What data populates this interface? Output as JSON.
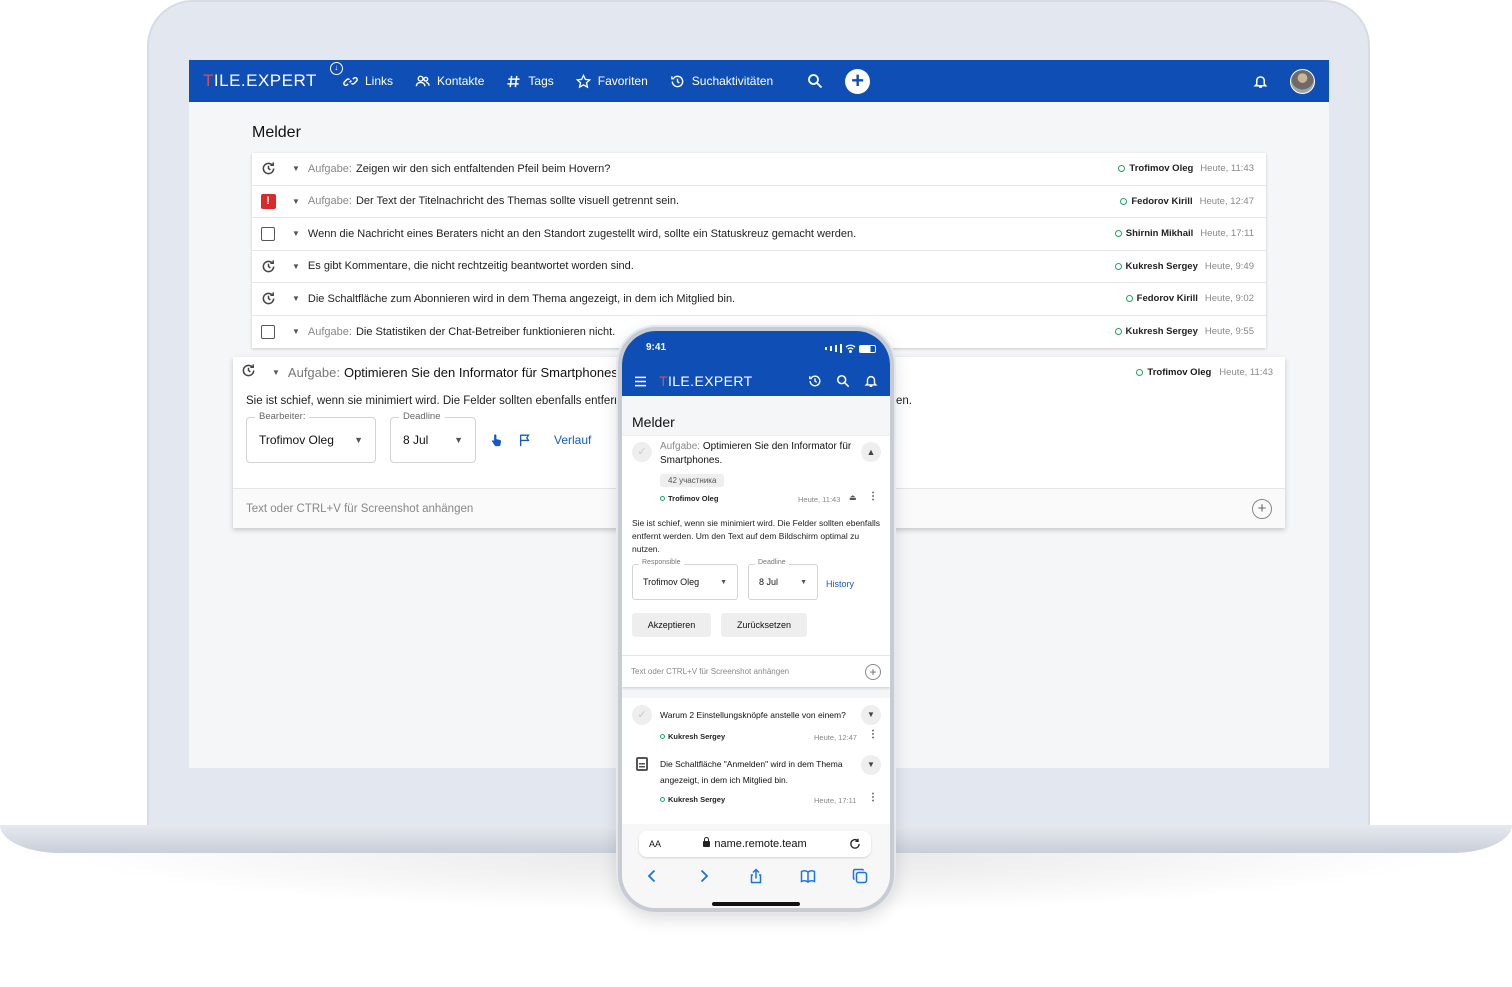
{
  "app": {
    "logo_prefix": "T",
    "logo_rest": "ILE.EXPERT",
    "nav": [
      {
        "label": "Links",
        "icon": "link-icon"
      },
      {
        "label": "Kontakte",
        "icon": "contacts-icon"
      },
      {
        "label": "Tags",
        "icon": "hash-icon"
      },
      {
        "label": "Favoriten",
        "icon": "star-icon"
      },
      {
        "label": "Suchaktivitäten",
        "icon": "history-icon"
      }
    ]
  },
  "page": {
    "title": "Melder"
  },
  "tasks": [
    {
      "status_icon": "recurring-icon",
      "prefix": "Aufgabe:",
      "text": "Zeigen wir den sich entfaltenden Pfeil beim Hovern?",
      "user": "Trofimov Oleg",
      "time": "Heute, 11:43"
    },
    {
      "status_icon": "alert-icon",
      "prefix": "Aufgabe:",
      "text": "Der Text der Titelnachricht des Themas sollte visuell getrennt sein.",
      "user": "Fedorov Kirill",
      "time": "Heute, 12:47"
    },
    {
      "status_icon": "checkbox-icon",
      "prefix": "",
      "text": "Wenn die Nachricht eines Beraters nicht an den Standort zugestellt wird, sollte ein Statuskreuz gemacht werden.",
      "user": "Shirnin Mikhail",
      "time": "Heute, 17:11"
    },
    {
      "status_icon": "recurring-icon",
      "prefix": "",
      "text": "Es gibt Kommentare, die nicht rechtzeitig beantwortet worden sind.",
      "user": "Kukresh Sergey",
      "time": "Heute, 9:49"
    },
    {
      "status_icon": "recurring-icon",
      "prefix": "",
      "text": "Die Schaltfläche zum Abonnieren wird in dem Thema angezeigt, in dem ich Mitglied bin.",
      "user": "Fedorov Kirill",
      "time": "Heute, 9:02"
    },
    {
      "status_icon": "checkbox-icon",
      "prefix": "Aufgabe:",
      "text": "Die Statistiken der Chat-Betreiber funktionieren nicht.",
      "user": "Kukresh Sergey",
      "time": "Heute, 9:55"
    }
  ],
  "expanded": {
    "prefix": "Aufgabe:",
    "title": "Optimieren Sie den Informator für Smartphones.",
    "user": "Trofimov Oleg",
    "time": "Heute, 11:43",
    "description_start": "Sie ist schief, wenn sie minimiert wird. Die Felder sollten ebenfalls entfernt w",
    "description_end": "zen.",
    "assignee_label": "Bearbeiter:",
    "assignee_value": "Trofimov Oleg",
    "deadline_label": "Deadline",
    "deadline_value": "8 Jul",
    "history_label": "Verlauf",
    "comment_placeholder": "Text oder CTRL+V für Screenshot anhängen"
  },
  "phone": {
    "status_time": "9:41",
    "title": "Melder",
    "card": {
      "prefix": "Aufgabe:",
      "title": "Optimieren Sie den Informator für Smartphones.",
      "participants": "42 участника",
      "user": "Trofimov Oleg",
      "time": "Heute, 11:43",
      "description": "Sie ist schief, wenn sie minimiert wird. Die Felder sollten ebenfalls entfernt werden. Um den Text auf dem Bildschirm optimal zu nutzen.",
      "responsible_label": "Responsible",
      "responsible_value": "Trofimov Oleg",
      "deadline_label": "Deadline",
      "deadline_value": "8 Jul",
      "history_label": "History",
      "accept_label": "Akzeptieren",
      "reset_label": "Zurücksetzen",
      "comment_placeholder": "Text oder CTRL+V für Screenshot anhängen"
    },
    "items": [
      {
        "text": "Warum 2 Einstellungsknöpfe anstelle von einem?",
        "user": "Kukresh Sergey",
        "time": "Heute, 12:47"
      },
      {
        "text": "Die Schaltfläche \"Anmelden\" wird in dem Thema angezeigt, in dem ich Mitglied bin.",
        "user": "Kukresh Sergey",
        "time": "Heute, 17:11"
      }
    ],
    "browser": {
      "aa": "AA",
      "url": "name.remote.team"
    }
  },
  "colors": {
    "brand": "#0f4fb5",
    "accent_red": "#e84848",
    "online": "#1fa463",
    "link": "#1559c9"
  }
}
